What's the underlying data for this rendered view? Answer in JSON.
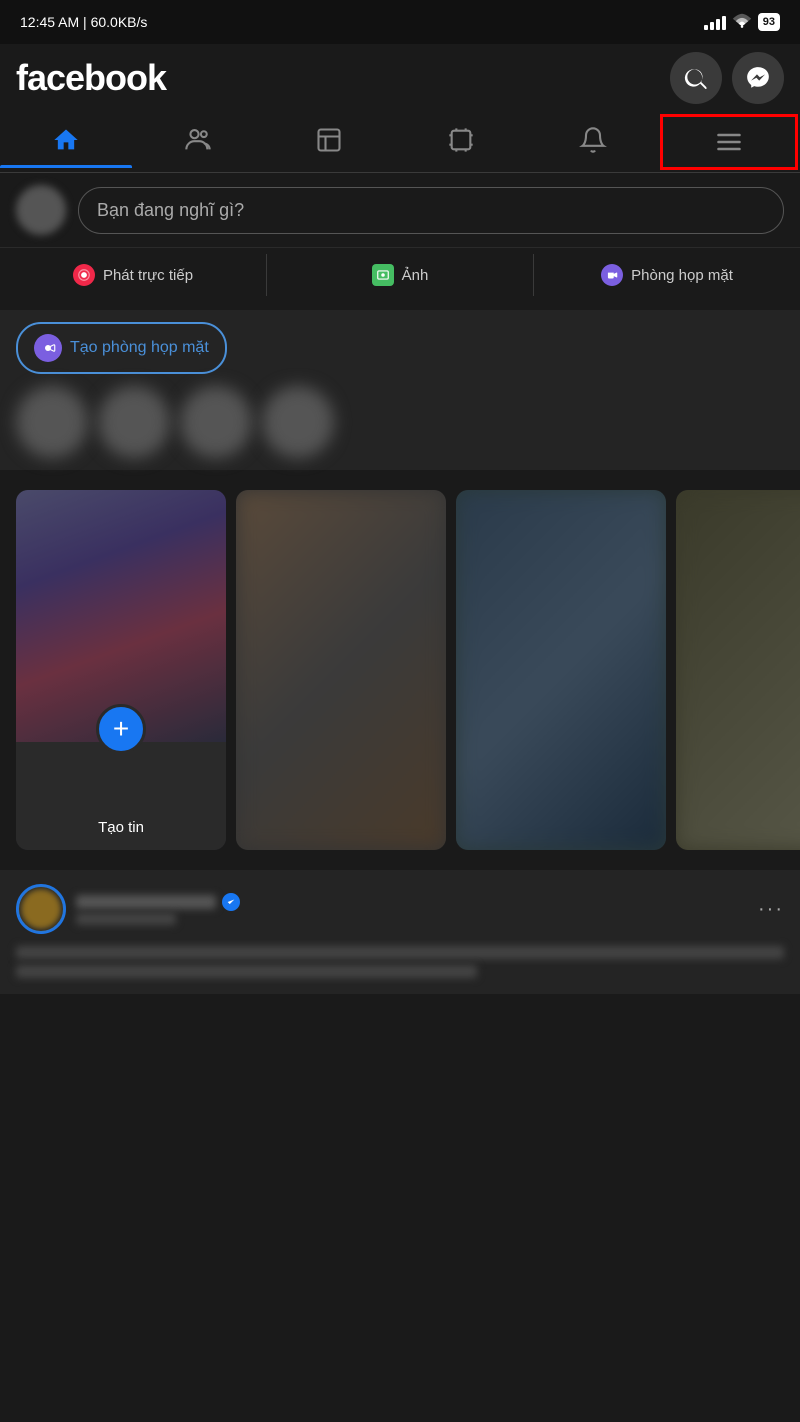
{
  "statusBar": {
    "time": "12:45 AM | 60.0KB/s",
    "battery": "93"
  },
  "header": {
    "logo": "facebook",
    "searchLabel": "Search",
    "messengerLabel": "Messenger"
  },
  "navTabs": [
    {
      "id": "home",
      "label": "Home",
      "active": true
    },
    {
      "id": "friends",
      "label": "Friends",
      "active": false
    },
    {
      "id": "marketplace",
      "label": "Marketplace",
      "active": false
    },
    {
      "id": "watch",
      "label": "Watch",
      "active": false
    },
    {
      "id": "notifications",
      "label": "Notifications",
      "active": false
    },
    {
      "id": "menu",
      "label": "Menu",
      "active": false,
      "highlight": true
    }
  ],
  "postBox": {
    "placeholder": "Bạn đang nghĩ gì?"
  },
  "actionRow": {
    "live": "Phát trực tiếp",
    "photo": "Ảnh",
    "room": "Phòng họp mặt"
  },
  "stories": {
    "createRoomBtn": "Tạo phòng họp mặt",
    "createStoryBtn": "Tạo tin"
  }
}
